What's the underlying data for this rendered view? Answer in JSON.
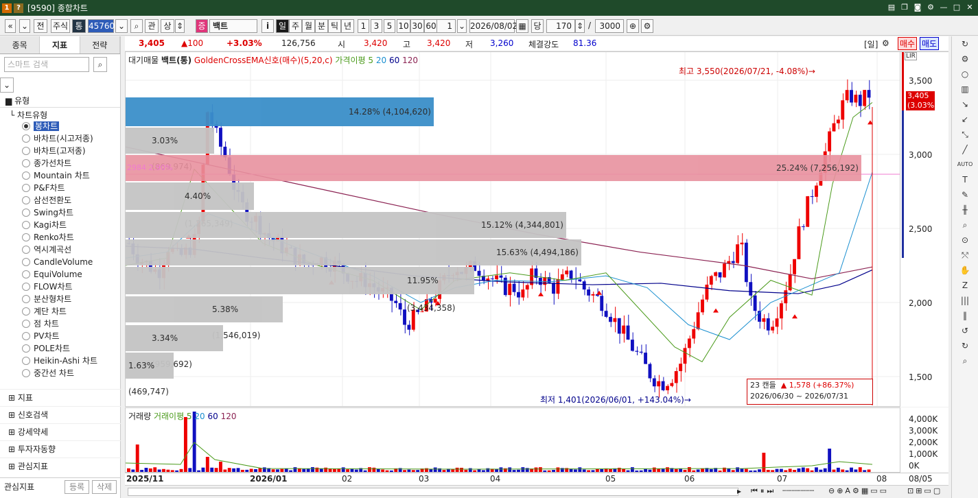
{
  "window": {
    "title": "[9590] 종합차트",
    "icon1": "1",
    "icon2": "?"
  },
  "toolbar": {
    "nav_prev": "«",
    "nav_down": "»",
    "jeon": "전",
    "market": "주식",
    "tong": "통",
    "code": "457600",
    "search_icon": "⌕",
    "gwan": "관",
    "sang": "상",
    "updown": "⇕",
    "jeung": "증",
    "stock_name": "백트",
    "info": "i",
    "periods": [
      "일",
      "주",
      "월",
      "분",
      "틱",
      "년"
    ],
    "minutes": [
      "1",
      "3",
      "5",
      "10",
      "30",
      "60"
    ],
    "unit": "1",
    "date": "2026/08/02",
    "dang": "당",
    "count": "170",
    "slash": "/",
    "total": "3000"
  },
  "sidebar": {
    "tabs": [
      "종목",
      "지표",
      "전략"
    ],
    "search_placeholder": "스마트 검색",
    "section": "유형",
    "tree_root": "차트유형",
    "items": [
      "봉차트",
      "바차트(시고저종)",
      "바차트(고저종)",
      "종가선차트",
      "Mountain 차트",
      "P&F차트",
      "삼선전환도",
      "Swing차트",
      "Kagi차트",
      "Renko차트",
      "역시계곡선",
      "CandleVolume",
      "EquiVolume",
      "FLOW차트",
      "분산형차트",
      "계단 차트",
      "점 차트",
      "PV차트",
      "POLE차트",
      "Heikin-Ashi 차트",
      "중간선 차트"
    ],
    "bottom": [
      "지표",
      "신호검색",
      "강세약세",
      "투자자동향",
      "관심지표"
    ],
    "footer_label": "관심지표",
    "footer_btn1": "등록",
    "footer_btn2": "삭제"
  },
  "quote": {
    "price": "3,405",
    "change": "▲100",
    "rate": "+3.03%",
    "volume": "126,756",
    "open_lbl": "시",
    "open": "3,420",
    "high_lbl": "고",
    "high": "3,420",
    "low_lbl": "저",
    "low": "3,260",
    "strength_lbl": "체결강도",
    "strength": "81.36",
    "period": "[일]",
    "buy": "매수",
    "sell": "매도"
  },
  "legend": {
    "l1": "대기매물",
    "l2": "백트(통)",
    "l3": "GoldenCrossEMA신호(매수)(5,20,c)",
    "l4": "가격이평 5",
    "l5": "20",
    "l6": "60",
    "l7": "120"
  },
  "volume_legend": {
    "l1": "거래량",
    "l2": "거래이평 5",
    "l3": "20",
    "l4": "60",
    "l5": "120"
  },
  "profile": [
    {
      "label": "14.28% (4,104,620)",
      "pct": 14.28
    },
    {
      "label": "3.03% (869,974)",
      "pct": 3.03
    },
    {
      "label": "25.24% (7,256,192)",
      "pct": 25.24
    },
    {
      "label": "4.40% (1,265,349)",
      "pct": 4.4
    },
    {
      "label": "15.12% (4,344,801)",
      "pct": 15.12
    },
    {
      "label": "15.63% (4,494,186)",
      "pct": 15.63
    },
    {
      "label": "11.95% (3,434,358)",
      "pct": 11.95
    },
    {
      "label": "5.38% (1,546,019)",
      "pct": 5.38
    },
    {
      "label": "3.34% (959,692)",
      "pct": 3.34
    },
    {
      "label": "1.63% (469,747)",
      "pct": 1.63
    }
  ],
  "annotations": {
    "high": "최고 3,550(2026/07/21, -4.08%)→",
    "low": "최저 1,401(2026/06/01, +143.04%)→",
    "box1": "23 캔들",
    "box2": "▲ 1,578 (+86.37%)",
    "box3": "2026/06/30 ~ 2026/07/31",
    "pink_label": "2984 2.90%"
  },
  "yaxis": {
    "ticks": [
      "3,500",
      "3,000",
      "2,500",
      "2,000",
      "1,500"
    ],
    "price_tag": "3,405",
    "rate_tag": "(3.03%)"
  },
  "vyaxis": {
    "ticks": [
      "4,000K",
      "3,000K",
      "2,000K",
      "1,000K",
      "0K"
    ]
  },
  "xaxis": {
    "ticks": [
      "2025/11",
      "2026/01",
      "02",
      "03",
      "04",
      "05",
      "06",
      "07",
      "08",
      "08/05"
    ]
  }
}
